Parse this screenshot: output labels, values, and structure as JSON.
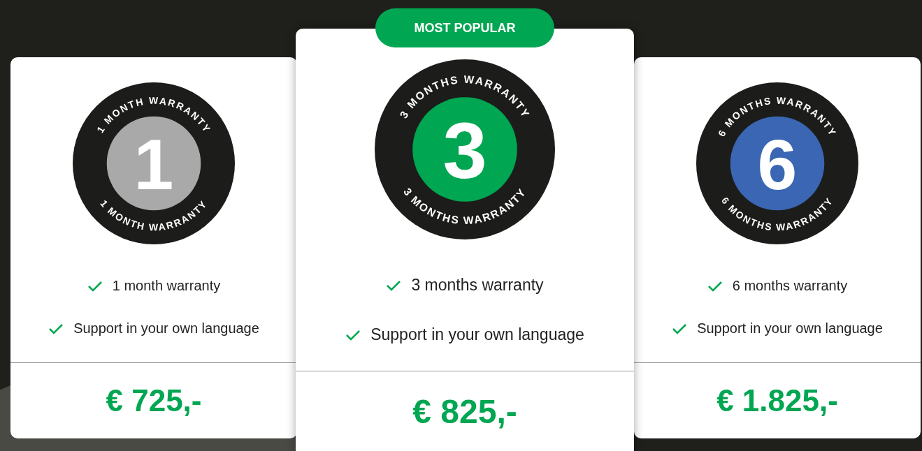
{
  "plans": [
    {
      "featured": false,
      "badge": {
        "number": "1",
        "top_text": "1 MONTH WARRANTY",
        "bottom_text": "1 MONTH WARRANTY",
        "color": "#a9a9a9"
      },
      "features": [
        "1 month warranty",
        "Support in your own language"
      ],
      "price": "€ 725,-"
    },
    {
      "featured": true,
      "ribbon": "MOST POPULAR",
      "badge": {
        "number": "3",
        "top_text": "3 MONTHS WARRANTY",
        "bottom_text": "3 MONTHS WARRANTY",
        "color": "#00a651"
      },
      "features": [
        "3 months warranty",
        "Support in your own language"
      ],
      "price": "€ 825,-"
    },
    {
      "featured": false,
      "badge": {
        "number": "6",
        "top_text": "6 MONTHS WARRANTY",
        "bottom_text": "6 MONTHS WARRANTY",
        "color": "#3a66b3"
      },
      "features": [
        "6 months warranty",
        "Support in your own language"
      ],
      "price": "€ 1.825,-"
    }
  ]
}
